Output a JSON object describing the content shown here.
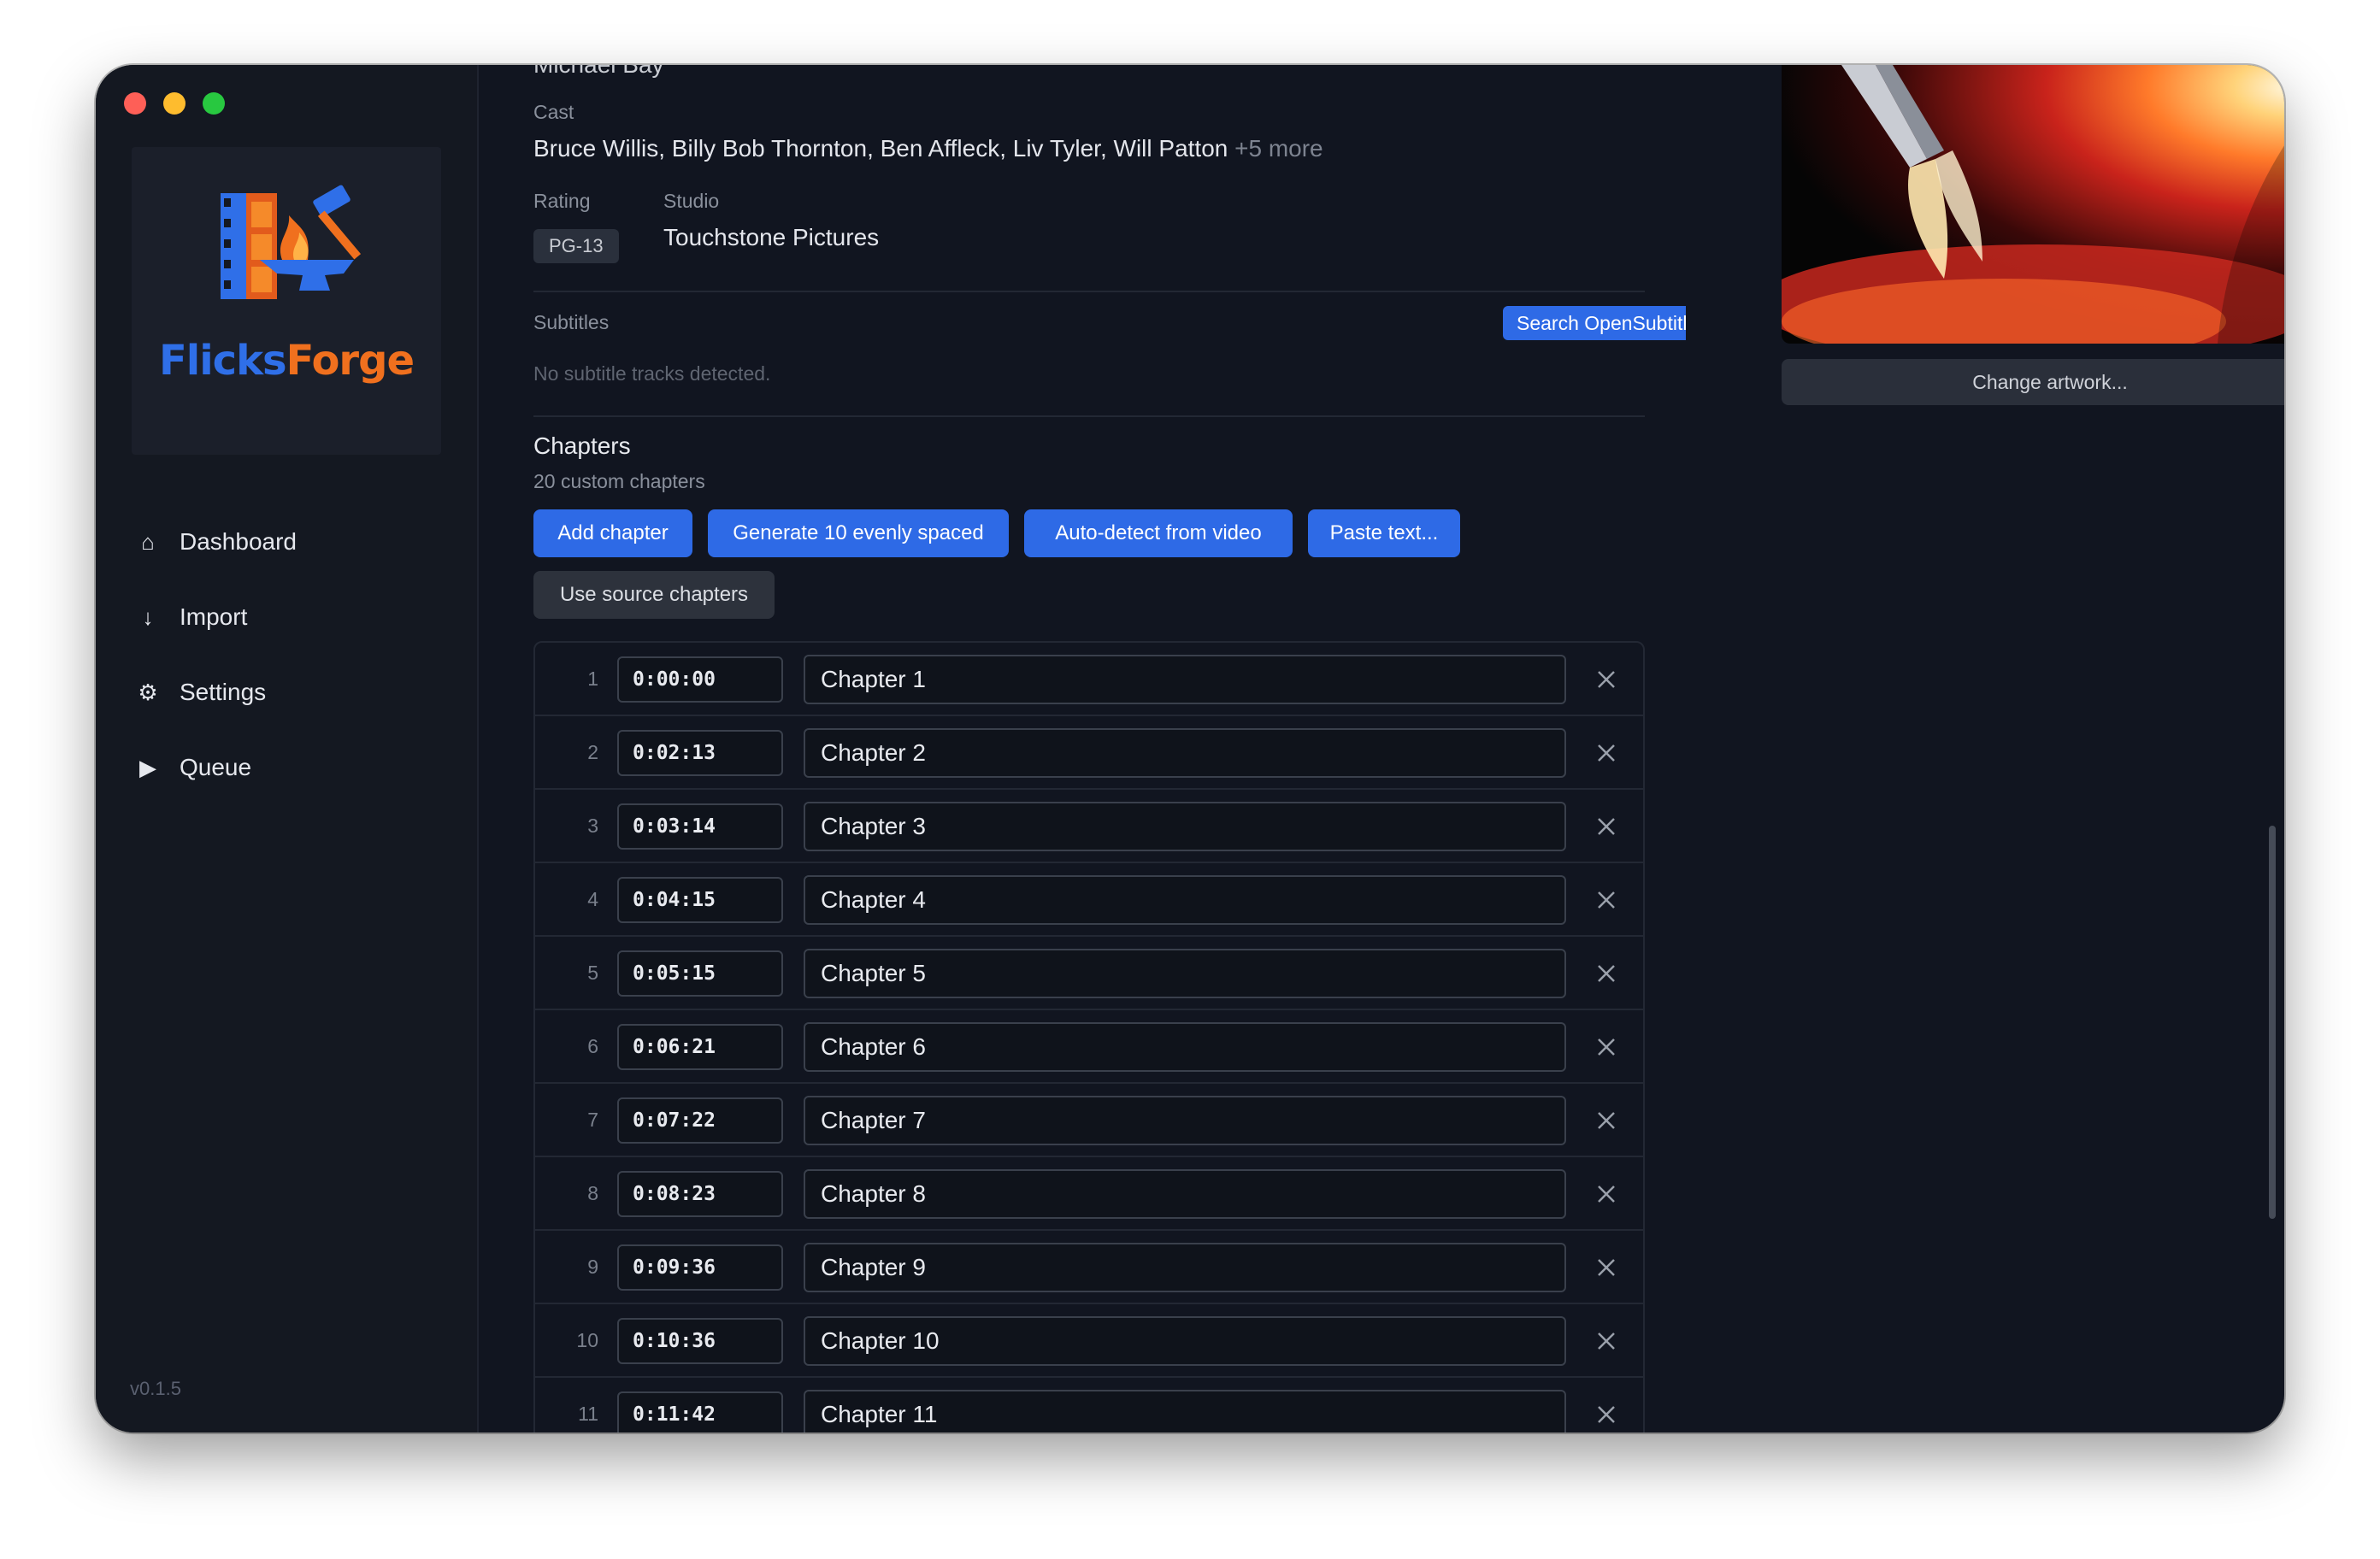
{
  "app": {
    "logo_text_1": "Flicks",
    "logo_text_2": "Forge",
    "version": "v0.1.5"
  },
  "sidebar": {
    "items": [
      {
        "label": "Dashboard",
        "icon": "home-icon"
      },
      {
        "label": "Import",
        "icon": "arrow-down-icon"
      },
      {
        "label": "Settings",
        "icon": "gear-icon"
      },
      {
        "label": "Queue",
        "icon": "play-icon"
      }
    ]
  },
  "metadata": {
    "director_partial": "Michael Bay",
    "cast_label": "Cast",
    "cast": "Bruce Willis, Billy Bob Thornton, Ben Affleck, Liv Tyler, Will Patton",
    "cast_more": "+5 more",
    "rating_label": "Rating",
    "rating": "PG-13",
    "studio_label": "Studio",
    "studio": "Touchstone Pictures"
  },
  "subtitles": {
    "label": "Subtitles",
    "search_button": "Search OpenSubtitles",
    "empty_message": "No subtitle tracks detected."
  },
  "chapters": {
    "title": "Chapters",
    "subtitle": "20 custom chapters",
    "buttons": {
      "add": "Add chapter",
      "generate": "Generate 10 evenly spaced",
      "autodetect": "Auto-detect from video",
      "paste": "Paste text...",
      "use_source": "Use source chapters"
    },
    "rows": [
      {
        "num": "1",
        "time": "0:00:00",
        "title": "Chapter 1"
      },
      {
        "num": "2",
        "time": "0:02:13",
        "title": "Chapter 2"
      },
      {
        "num": "3",
        "time": "0:03:14",
        "title": "Chapter 3"
      },
      {
        "num": "4",
        "time": "0:04:15",
        "title": "Chapter 4"
      },
      {
        "num": "5",
        "time": "0:05:15",
        "title": "Chapter 5"
      },
      {
        "num": "6",
        "time": "0:06:21",
        "title": "Chapter 6"
      },
      {
        "num": "7",
        "time": "0:07:22",
        "title": "Chapter 7"
      },
      {
        "num": "8",
        "time": "0:08:23",
        "title": "Chapter 8"
      },
      {
        "num": "9",
        "time": "0:09:36",
        "title": "Chapter 9"
      },
      {
        "num": "10",
        "time": "0:10:36",
        "title": "Chapter 10"
      },
      {
        "num": "11",
        "time": "0:11:42",
        "title": "Chapter 11"
      }
    ]
  },
  "artwork": {
    "change_button": "Change artwork..."
  }
}
